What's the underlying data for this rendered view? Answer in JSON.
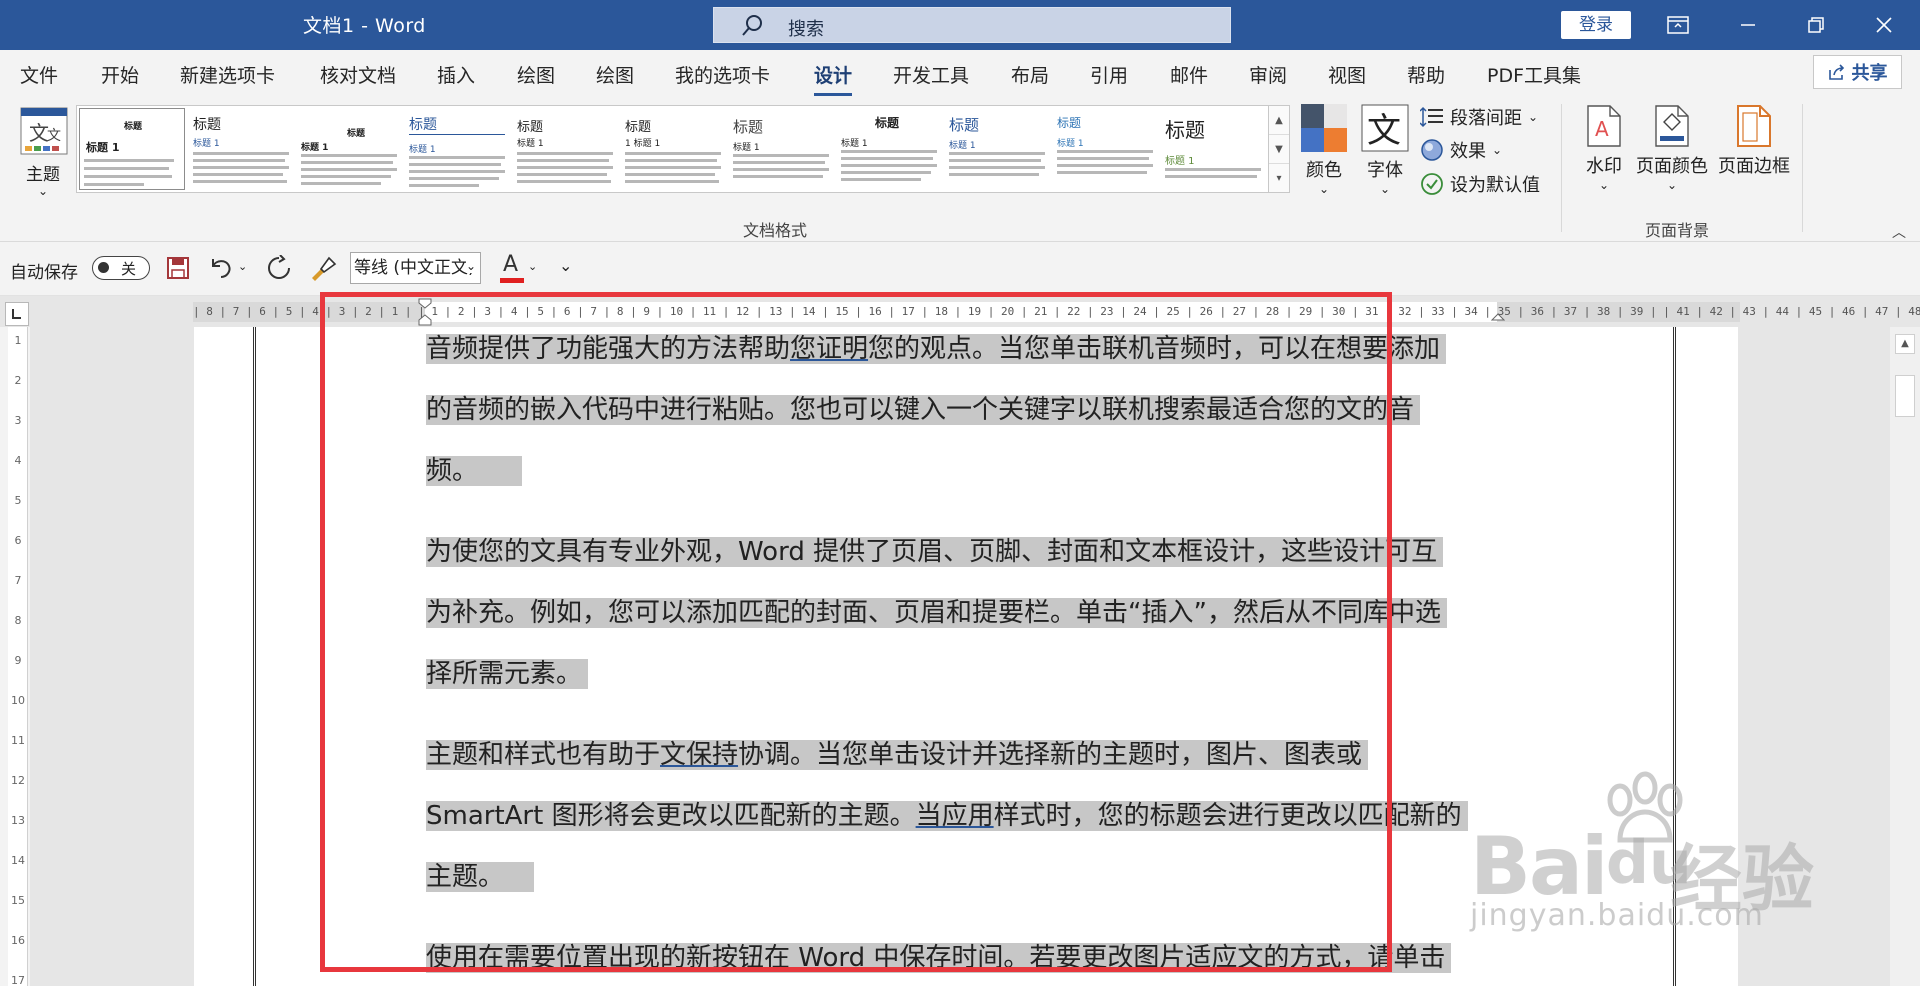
{
  "window": {
    "title": "文档1  -  Word",
    "search_placeholder": "搜索",
    "login_label": "登录"
  },
  "tabs": [
    "文件",
    "开始",
    "新建选项卡",
    "核对文档",
    "插入",
    "绘图",
    "绘图",
    "我的选项卡",
    "设计",
    "开发工具",
    "布局",
    "引用",
    "邮件",
    "审阅",
    "视图",
    "帮助",
    "PDF工具集"
  ],
  "active_tab": "设计",
  "share_label": "共享",
  "ribbon": {
    "theme_label": "主题",
    "style_thumbs": [
      {
        "title": "标题",
        "heading": "标题 1"
      },
      {
        "title": "标题",
        "heading": "标题 1"
      },
      {
        "title": "标题",
        "heading": "标题 1"
      },
      {
        "title": "标题",
        "heading": "标题 1"
      },
      {
        "title": "标题",
        "heading": "标题 1"
      },
      {
        "title": "标题",
        "heading": "1 标题 1"
      },
      {
        "title": "标题",
        "heading": "标题 1"
      },
      {
        "title": "标题",
        "heading": "标题 1"
      },
      {
        "title": "标题",
        "heading": "标题 1"
      },
      {
        "title": "标题",
        "heading": "标题 1"
      },
      {
        "title": "标题",
        "heading": "标题 1"
      }
    ],
    "colors_label": "颜色",
    "fonts_label": "字体",
    "paragraph_spacing_label": "段落间距",
    "effects_label": "效果",
    "set_default_label": "设为默认值",
    "doc_format_group": "文档格式",
    "watermark_label": "水印",
    "page_color_label": "页面颜色",
    "page_border_label": "页面边框",
    "page_background_group": "页面背景"
  },
  "qat": {
    "autosave_label": "自动保存",
    "toggle_state": "关",
    "font_name": "等线 (中文正文)"
  },
  "ruler_numbers": "| 8 | 7 | 6 | 5 | 4 | 3 | 2 | 1 |   | 1 | 2 | 3 | 4 | 5 | 6 | 7 | 8 | 9 | 10 | 11 | 12 | 13 | 14 | 15 | 16 | 17 | 18 | 19 | 20 | 21 | 22 | 23 | 24 | 25 | 26 | 27 | 28 | 29 | 30 | 31 | 32 | 33 | 34 | 35 | 36 | 37 | 38 | 39 |   | 41 | 42 | 43 | 44 | 45 | 46 | 47 | 48",
  "vruler_numbers": [
    "1",
    "2",
    "3",
    "4",
    "5",
    "6",
    "7",
    "8",
    "9",
    "10",
    "11",
    "12",
    "13",
    "14",
    "15",
    "16",
    "17"
  ],
  "document": {
    "lines": [
      [
        "音频提供了功能强大的方法帮助",
        "您证明",
        "您的观点。当您单击联机音频时，可以在想要添加"
      ],
      [
        "的音频的嵌入代码中进行粘贴。您也可以键入一个关键字以联机搜索最适合您的文的音"
      ],
      [
        "频。"
      ],
      [
        "为使您的文具有专业外观，Word 提供了页眉、页脚、封面和文本框设计，这些设计可互"
      ],
      [
        "为补充。例如，您可以添加匹配的封面、页眉和提要栏。单击“插入”，然后从不同库中选"
      ],
      [
        "择所需元素。"
      ],
      [
        "主题和样式也有助于",
        "文保持",
        "协调。当您单击设计并选择新的主题时，图片、图表或"
      ],
      [
        "SmartArt 图形将会更改以匹配新的主题。",
        "当应用",
        "样式时，您的标题会进行更改以匹配新的"
      ],
      [
        "主题。"
      ],
      [
        "使用在需要位置出现的新按钮在 Word 中保存时间。若要更改图片适应文的方式，请单击"
      ]
    ]
  },
  "watermark": {
    "brand": "Bai",
    "brand_cn": "经验",
    "url": "jingyan.baidu.com"
  }
}
